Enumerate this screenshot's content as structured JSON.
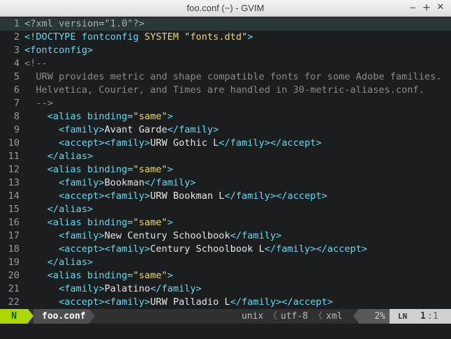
{
  "window": {
    "title": "foo.conf (~) - GVIM",
    "min_glyph": "−",
    "max_glyph": "+",
    "close_glyph": "✕"
  },
  "editor": {
    "lines": [
      {
        "n": "1",
        "code": "<?xml version=\"1.0\"?>"
      },
      {
        "n": "2",
        "code": "<!DOCTYPE fontconfig SYSTEM \"fonts.dtd\">"
      },
      {
        "n": "3",
        "code": "<fontconfig>"
      },
      {
        "n": "4",
        "code": "<!--"
      },
      {
        "n": "5",
        "code": "  URW provides metric and shape compatible fonts for some Adobe families."
      },
      {
        "n": "6",
        "code": "  Helvetica, Courier, and Times are handled in 30-metric-aliases.conf."
      },
      {
        "n": "7",
        "code": "  -->"
      },
      {
        "n": "8",
        "code": "    <alias binding=\"same\">"
      },
      {
        "n": "9",
        "code": "      <family>Avant Garde</family>"
      },
      {
        "n": "10",
        "code": "      <accept><family>URW Gothic L</family></accept>"
      },
      {
        "n": "11",
        "code": "    </alias>"
      },
      {
        "n": "12",
        "code": "    <alias binding=\"same\">"
      },
      {
        "n": "13",
        "code": "      <family>Bookman</family>"
      },
      {
        "n": "14",
        "code": "      <accept><family>URW Bookman L</family></accept>"
      },
      {
        "n": "15",
        "code": "    </alias>"
      },
      {
        "n": "16",
        "code": "    <alias binding=\"same\">"
      },
      {
        "n": "17",
        "code": "      <family>New Century Schoolbook</family>"
      },
      {
        "n": "18",
        "code": "      <accept><family>Century Schoolbook L</family></accept>"
      },
      {
        "n": "19",
        "code": "    </alias>"
      },
      {
        "n": "20",
        "code": "    <alias binding=\"same\">"
      },
      {
        "n": "21",
        "code": "      <family>Palatino</family>"
      },
      {
        "n": "22",
        "code": "      <accept><family>URW Palladio L</family></accept>"
      }
    ]
  },
  "statusline": {
    "mode": "N",
    "filename": "foo.conf",
    "fileformat": "unix",
    "encoding": "utf-8",
    "filetype": "xml",
    "percent": "2%",
    "line_icon": "LN",
    "line": "1",
    "colon": ":",
    "col": "1",
    "sep_glyph": "〈"
  },
  "colors": {
    "background": "#1b1d1e",
    "cursorline": "#293739",
    "tag": "#66d9ef",
    "string": "#e6db74",
    "comment": "#8c8c8c",
    "mode_bg": "#afd700",
    "mode_fg": "#005f00"
  }
}
